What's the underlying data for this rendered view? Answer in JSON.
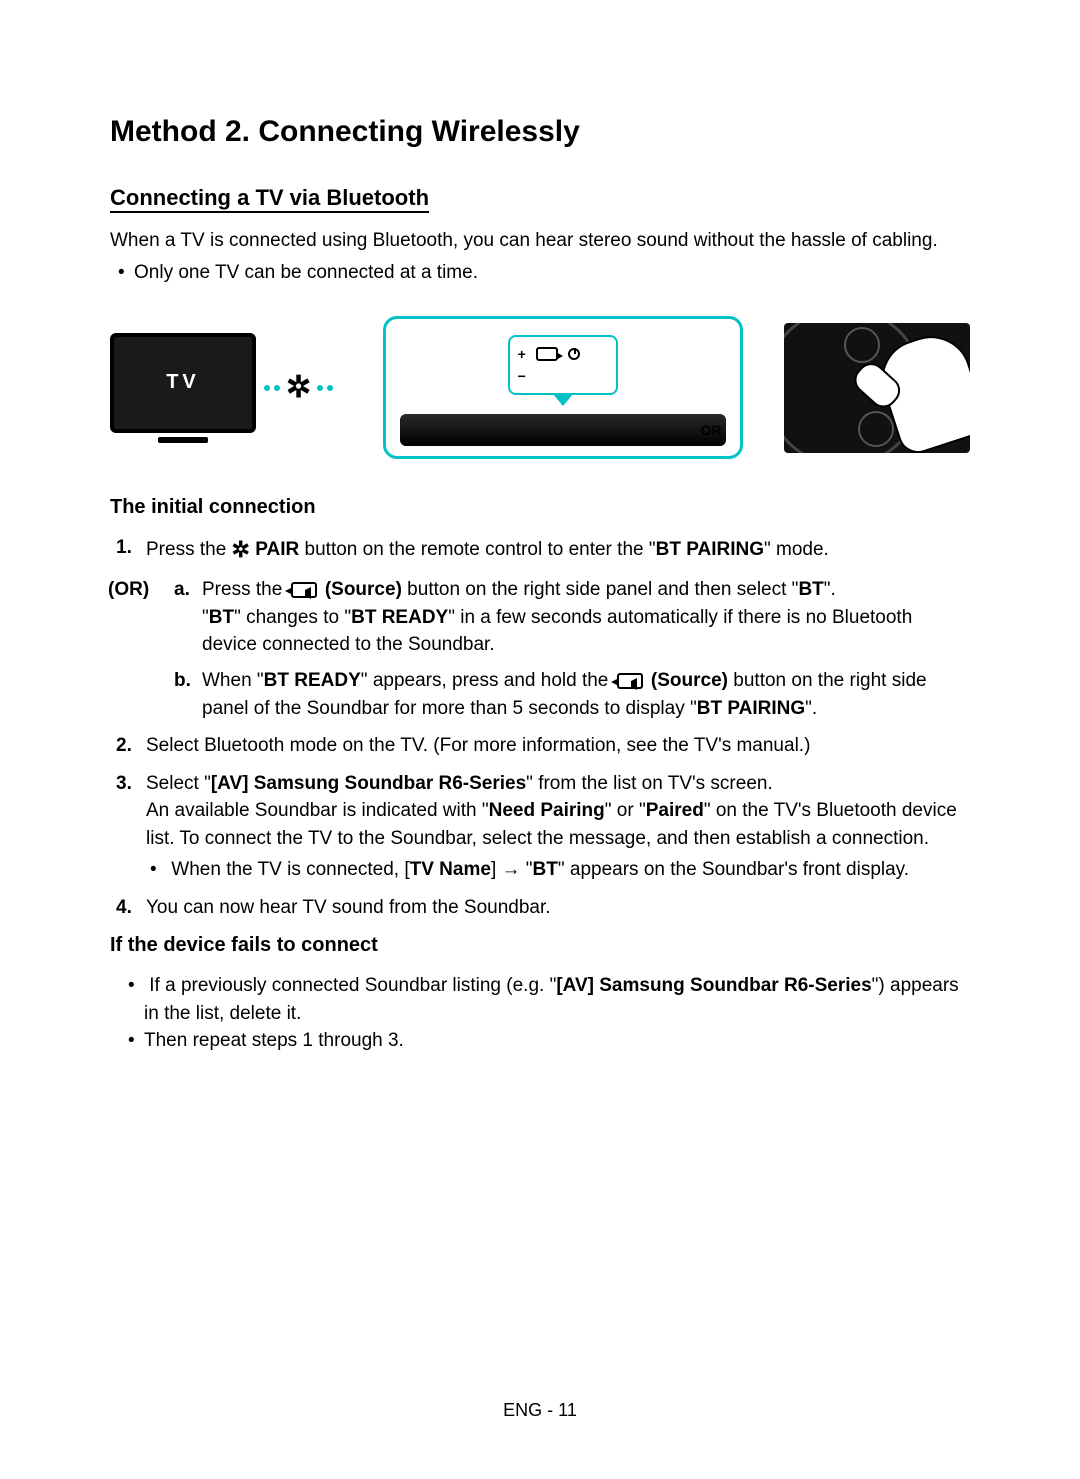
{
  "title": "Method 2. Connecting Wirelessly",
  "subtitle": "Connecting a TV via Bluetooth",
  "intro": "When a TV is connected using Bluetooth, you can hear stereo sound without the hassle of cabling.",
  "note_bullet": "Only one TV can be connected at a time.",
  "diagram": {
    "tv_label": "TV",
    "or_label": "OR",
    "plus": "+",
    "minus": "−"
  },
  "sec_initial": "The initial connection",
  "or_label": "(OR)",
  "step1_a": "Press the ",
  "step1_pair": " PAIR",
  "step1_b": " button on the remote control to enter the \"",
  "step1_mode": "BT PAIRING",
  "step1_c": "\" mode.",
  "or_a_1": "Press the ",
  "or_a_src": " (Source)",
  "or_a_2": " button on the right side panel and then select \"",
  "or_a_bt": "BT",
  "or_a_3": "\".",
  "or_a_line2_a": "\"",
  "or_a_line2_bt": "BT",
  "or_a_line2_b": "\" changes to \"",
  "or_a_line2_ready": "BT READY",
  "or_a_line2_c": "\" in a few seconds automatically if there is no Bluetooth device connected to the Soundbar.",
  "or_b_1": "When \"",
  "or_b_ready": "BT READY",
  "or_b_2": "\" appears, press and hold the ",
  "or_b_src": " (Source)",
  "or_b_3": " button on the right side panel of the Soundbar for more than 5 seconds to display \"",
  "or_b_pairing": "BT PAIRING",
  "or_b_4": "\".",
  "step2": "Select Bluetooth mode on the TV. (For more information, see the TV's manual.)",
  "step3_a": "Select \"",
  "step3_dev": "[AV] Samsung Soundbar R6-Series",
  "step3_b": "\" from the list on TV's screen.",
  "step3_line2_a": "An available Soundbar is indicated with \"",
  "step3_need": "Need Pairing",
  "step3_line2_b": "\" or \"",
  "step3_paired": "Paired",
  "step3_line2_c": "\" on the TV's Bluetooth device list. To connect the TV to the Soundbar, select the message, and then establish a connection.",
  "step3_sub_a": "When the TV is connected, [",
  "step3_tvname": "TV Name",
  "step3_sub_b": "] → \"",
  "step3_sub_bt": "BT",
  "step3_sub_c": "\" appears on the Soundbar's front display.",
  "step4": "You can now hear TV sound from the Soundbar.",
  "sec_fail": "If the device fails to connect",
  "fail1_a": "If a previously connected Soundbar listing (e.g. \"",
  "fail1_dev": "[AV] Samsung Soundbar R6-Series",
  "fail1_b": "\") appears in the list, delete it.",
  "fail2": "Then repeat steps 1 through 3.",
  "footer": "ENG - 11"
}
